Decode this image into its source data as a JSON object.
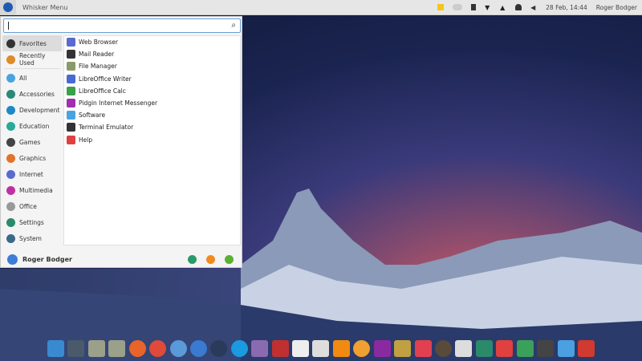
{
  "panel": {
    "app_title": "Whisker Menu",
    "clock": "28 Feb, 14:44",
    "user": "Roger Bodger",
    "tray_icons": [
      "notes-icon",
      "weather-icon",
      "battery-icon",
      "wifi-icon",
      "vlc-tray-icon",
      "notification-bell-icon",
      "volume-icon"
    ]
  },
  "menu": {
    "search": {
      "value": "",
      "icon": "search-icon"
    },
    "categories": [
      {
        "label": "Favorites",
        "icon": "bookmark-icon",
        "color": "#333333",
        "selected": true
      },
      {
        "label": "Recently Used",
        "icon": "clock-icon",
        "color": "#e08a2a"
      },
      {
        "label": "All",
        "icon": "all-apps-icon",
        "color": "#4aa3e0"
      },
      {
        "label": "Accessories",
        "icon": "accessories-icon",
        "color": "#2a8a7a"
      },
      {
        "label": "Development",
        "icon": "development-icon",
        "color": "#1e88c8"
      },
      {
        "label": "Education",
        "icon": "education-icon",
        "color": "#2aa89a"
      },
      {
        "label": "Games",
        "icon": "gamepad-icon",
        "color": "#444444"
      },
      {
        "label": "Graphics",
        "icon": "graphics-icon",
        "color": "#e0742a"
      },
      {
        "label": "Internet",
        "icon": "internet-icon",
        "color": "#5a6ad0"
      },
      {
        "label": "Multimedia",
        "icon": "multimedia-icon",
        "color": "#c030a0"
      },
      {
        "label": "Office",
        "icon": "office-icon",
        "color": "#999999"
      },
      {
        "label": "Settings",
        "icon": "settings-icon",
        "color": "#2a8a6a"
      },
      {
        "label": "System",
        "icon": "system-icon",
        "color": "#3a6a8a"
      }
    ],
    "apps": [
      {
        "label": "Web Browser",
        "icon": "web-browser-icon",
        "color": "#5a6ad0"
      },
      {
        "label": "Mail Reader",
        "icon": "mail-reader-icon",
        "color": "#333333"
      },
      {
        "label": "File Manager",
        "icon": "file-manager-icon",
        "color": "#8a9a6a"
      },
      {
        "label": "LibreOffice Writer",
        "icon": "libreoffice-writer-icon",
        "color": "#4a6ad0"
      },
      {
        "label": "LibreOffice Calc",
        "icon": "libreoffice-calc-icon",
        "color": "#3aa04a"
      },
      {
        "label": "Pidgin Internet Messenger",
        "icon": "pidgin-icon",
        "color": "#a030b0"
      },
      {
        "label": "Software",
        "icon": "software-icon",
        "color": "#4aa3e0"
      },
      {
        "label": "Terminal Emulator",
        "icon": "terminal-icon",
        "color": "#333333"
      },
      {
        "label": "Help",
        "icon": "help-lifebuoy-icon",
        "color": "#e04040"
      }
    ],
    "footer": {
      "user": "Roger Bodger",
      "actions": [
        {
          "icon": "settings-manager-icon",
          "color": "#2a9a6a"
        },
        {
          "icon": "lock-screen-icon",
          "color": "#f08a20"
        },
        {
          "icon": "logout-icon",
          "color": "#5ab030"
        }
      ]
    }
  },
  "dock": [
    {
      "icon": "anchor-icon",
      "color": "#3a8ad0"
    },
    {
      "icon": "screenshot-icon",
      "color": "#4a5a6a"
    },
    {
      "icon": "file-manager-icon",
      "color": "#9aa08a"
    },
    {
      "icon": "file-manager-icon",
      "color": "#9aa08a"
    },
    {
      "icon": "firefox-icon",
      "color": "#e8642a"
    },
    {
      "icon": "chrome-icon",
      "color": "#e04a3a"
    },
    {
      "icon": "chromium-icon",
      "color": "#5a9ad8"
    },
    {
      "icon": "thunderbird-icon",
      "color": "#3a7ad0"
    },
    {
      "icon": "steam-icon",
      "color": "#2a3a5a"
    },
    {
      "icon": "skype-icon",
      "color": "#1a9ae0"
    },
    {
      "icon": "pidgin-icon",
      "color": "#8a6ab0"
    },
    {
      "icon": "transmission-icon",
      "color": "#c03030"
    },
    {
      "icon": "document-icon",
      "color": "#eeeeee"
    },
    {
      "icon": "draw-icon",
      "color": "#dddddd"
    },
    {
      "icon": "vlc-icon",
      "color": "#f08a10"
    },
    {
      "icon": "orange-icon",
      "color": "#f0a030"
    },
    {
      "icon": "video-player-icon",
      "color": "#8a2aa0"
    },
    {
      "icon": "speaker-icon",
      "color": "#c0a040"
    },
    {
      "icon": "image-viewer-icon",
      "color": "#e04050"
    },
    {
      "icon": "eyes-icon",
      "color": "#5a4a3a"
    },
    {
      "icon": "software-install-icon",
      "color": "#dddddd"
    },
    {
      "icon": "settings-icon",
      "color": "#2a8a6a"
    },
    {
      "icon": "search-icon",
      "color": "#e04040"
    },
    {
      "icon": "system-monitor-icon",
      "color": "#3aa05a"
    },
    {
      "icon": "terminal-icon",
      "color": "#444444"
    },
    {
      "icon": "desktop-icon",
      "color": "#4aa0e0"
    },
    {
      "icon": "trash-icon",
      "color": "#d03a30"
    }
  ]
}
